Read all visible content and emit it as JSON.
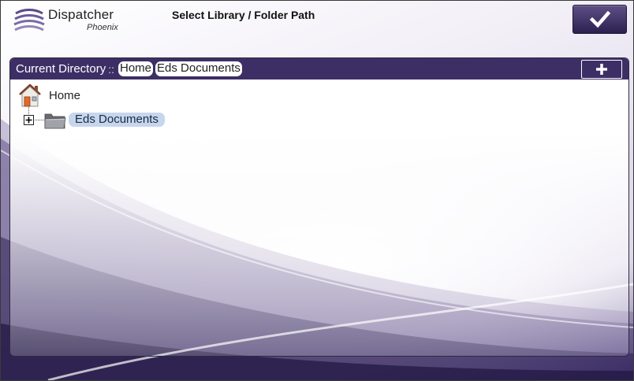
{
  "app": {
    "name": "Dispatcher",
    "edition": "Phoenix"
  },
  "header": {
    "title": "Select Library / Folder Path"
  },
  "panel": {
    "current_directory_label": "Current Directory",
    "separator": "::",
    "breadcrumbs": [
      "Home",
      "Eds Documents"
    ]
  },
  "tree": {
    "root": {
      "label": "Home",
      "icon": "home-icon"
    },
    "children": [
      {
        "label": "Eds Documents",
        "icon": "folder-icon",
        "selected": true,
        "expandable": true
      }
    ]
  },
  "colors": {
    "accent": "#3d2f66",
    "selection": "#c6d6ec"
  }
}
